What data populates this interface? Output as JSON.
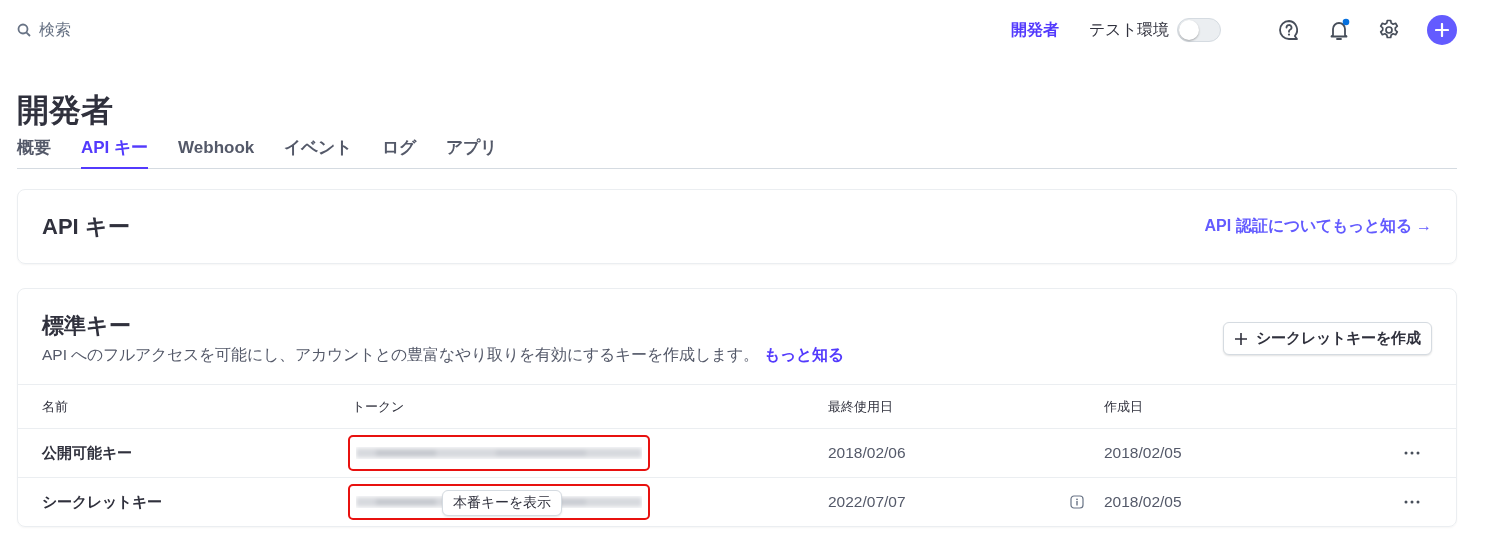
{
  "topbar": {
    "search": {
      "placeholder": "検索"
    },
    "developer_link": "開発者",
    "test_mode": {
      "label": "テスト環境",
      "on": false
    },
    "notifications": {
      "unread": true
    }
  },
  "page_title": "開発者",
  "tabs": [
    {
      "label": "概要",
      "selected": false
    },
    {
      "label": "API キー",
      "selected": true
    },
    {
      "label": "Webhook",
      "selected": false
    },
    {
      "label": "イベント",
      "selected": false
    },
    {
      "label": "ログ",
      "selected": false
    },
    {
      "label": "アプリ",
      "selected": false
    }
  ],
  "api_card": {
    "title": "API キー",
    "link": "API 認証についてもっと知る →"
  },
  "standard_keys": {
    "title": "標準キー",
    "description": "API へのフルアクセスを可能にし、アカウントとの豊富なやり取りを有効にするキーを作成します。",
    "description_link": "もっと知る",
    "create_button": "シークレットキーを作成",
    "columns": [
      "名前",
      "トークン",
      "最終使用日",
      "作成日"
    ],
    "rows": [
      {
        "name": "公開可能キー",
        "highlighted": true,
        "last_used": "2018/02/06",
        "info": false,
        "created": "2018/02/05"
      },
      {
        "name": "シークレットキー",
        "highlighted": true,
        "reveal_button": "本番キーを表示",
        "last_used": "2022/07/07",
        "info": true,
        "created": "2018/02/05"
      }
    ]
  }
}
